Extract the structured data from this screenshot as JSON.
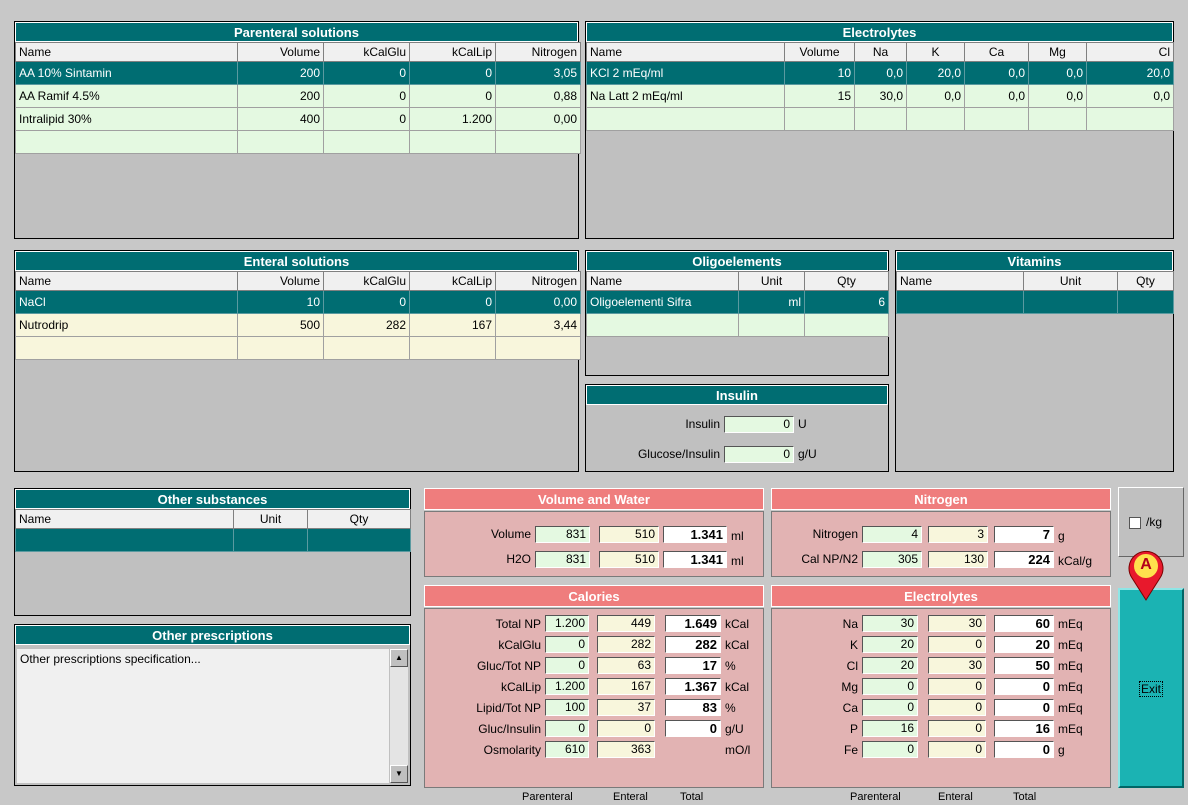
{
  "parenteral": {
    "title": "Parenteral solutions",
    "cols": [
      "Name",
      "Volume",
      "kCalGlu",
      "kCalLip",
      "Nitrogen"
    ],
    "rows": [
      [
        "AA 10% Sintamin",
        "200",
        "0",
        "0",
        "3,05"
      ],
      [
        "AA Ramif 4.5%",
        "200",
        "0",
        "0",
        "0,88"
      ],
      [
        "Intralipid 30%",
        "400",
        "0",
        "1.200",
        "0,00"
      ]
    ]
  },
  "electrolytes_top": {
    "title": "Electrolytes",
    "cols": [
      "Name",
      "Volume",
      "Na",
      "K",
      "Ca",
      "Mg",
      "Cl"
    ],
    "rows": [
      [
        "KCl 2 mEq/ml",
        "10",
        "0,0",
        "20,0",
        "0,0",
        "0,0",
        "20,0"
      ],
      [
        "Na Latt 2 mEq/ml",
        "15",
        "30,0",
        "0,0",
        "0,0",
        "0,0",
        "0,0"
      ]
    ]
  },
  "enteral": {
    "title": "Enteral solutions",
    "cols": [
      "Name",
      "Volume",
      "kCalGlu",
      "kCalLip",
      "Nitrogen"
    ],
    "rows": [
      [
        "NaCl",
        "10",
        "0",
        "0",
        "0,00"
      ],
      [
        "Nutrodrip",
        "500",
        "282",
        "167",
        "3,44"
      ]
    ]
  },
  "oligo": {
    "title": "Oligoelements",
    "cols": [
      "Name",
      "Unit",
      "Qty"
    ],
    "rows": [
      [
        "Oligoelementi Sifra",
        "ml",
        "6"
      ]
    ]
  },
  "vitamins": {
    "title": "Vitamins",
    "cols": [
      "Name",
      "Unit",
      "Qty"
    ]
  },
  "insulin": {
    "title": "Insulin",
    "insulin_label": "Insulin",
    "insulin_value": "0",
    "insulin_unit": "U",
    "glucose_label": "Glucose/Insulin",
    "glucose_value": "0",
    "glucose_unit": "g/U"
  },
  "other_substances": {
    "title": "Other substances",
    "cols": [
      "Name",
      "Unit",
      "Qty"
    ]
  },
  "other_prescriptions": {
    "title": "Other prescriptions",
    "text": "Other prescriptions specification..."
  },
  "volume_water": {
    "title": "Volume and Water",
    "rows": [
      {
        "label": "Volume",
        "p": "831",
        "e": "510",
        "t": "1.341",
        "unit": "ml"
      },
      {
        "label": "H2O",
        "p": "831",
        "e": "510",
        "t": "1.341",
        "unit": "ml"
      }
    ]
  },
  "nitrogen": {
    "title": "Nitrogen",
    "rows": [
      {
        "label": "Nitrogen",
        "p": "4",
        "e": "3",
        "t": "7",
        "unit": "g"
      },
      {
        "label": "Cal NP/N2",
        "p": "305",
        "e": "130",
        "t": "224",
        "unit": "kCal/g"
      }
    ]
  },
  "calories": {
    "title": "Calories",
    "rows": [
      {
        "label": "Total NP",
        "p": "1.200",
        "e": "449",
        "t": "1.649",
        "unit": "kCal"
      },
      {
        "label": "kCalGlu",
        "p": "0",
        "e": "282",
        "t": "282",
        "unit": "kCal"
      },
      {
        "label": "Gluc/Tot NP",
        "p": "0",
        "e": "63",
        "t": "17",
        "unit": "%"
      },
      {
        "label": "kCalLip",
        "p": "1.200",
        "e": "167",
        "t": "1.367",
        "unit": "kCal"
      },
      {
        "label": "Lipid/Tot NP",
        "p": "100",
        "e": "37",
        "t": "83",
        "unit": "%"
      },
      {
        "label": "Gluc/Insulin",
        "p": "0",
        "e": "0",
        "t": "0",
        "unit": "g/U"
      },
      {
        "label": "Osmolarity",
        "p": "610",
        "e": "363",
        "unit": "mO/l"
      }
    ]
  },
  "electrolytes_sum": {
    "title": "Electrolytes",
    "rows": [
      {
        "label": "Na",
        "p": "30",
        "e": "30",
        "t": "60",
        "unit": "mEq"
      },
      {
        "label": "K",
        "p": "20",
        "e": "0",
        "t": "20",
        "unit": "mEq"
      },
      {
        "label": "Cl",
        "p": "20",
        "e": "30",
        "t": "50",
        "unit": "mEq"
      },
      {
        "label": "Mg",
        "p": "0",
        "e": "0",
        "t": "0",
        "unit": "mEq"
      },
      {
        "label": "Ca",
        "p": "0",
        "e": "0",
        "t": "0",
        "unit": "mEq"
      },
      {
        "label": "P",
        "p": "16",
        "e": "0",
        "t": "16",
        "unit": "mEq"
      },
      {
        "label": "Fe",
        "p": "0",
        "e": "0",
        "t": "0",
        "unit": "g"
      }
    ]
  },
  "footer": {
    "parenteral": "Parenteral",
    "enteral": "Enteral",
    "total": "Total"
  },
  "perkg_label": "/kg",
  "exit_label": "Exit",
  "marker_label": "A",
  "colors": {
    "teal": "#006d72",
    "pink_header": "#ef7d7d",
    "pink_bg": "#e2b3b3",
    "green_row": "#e4f9e1",
    "yellow_row": "#f8f6dc",
    "marker": "#e8192c"
  }
}
